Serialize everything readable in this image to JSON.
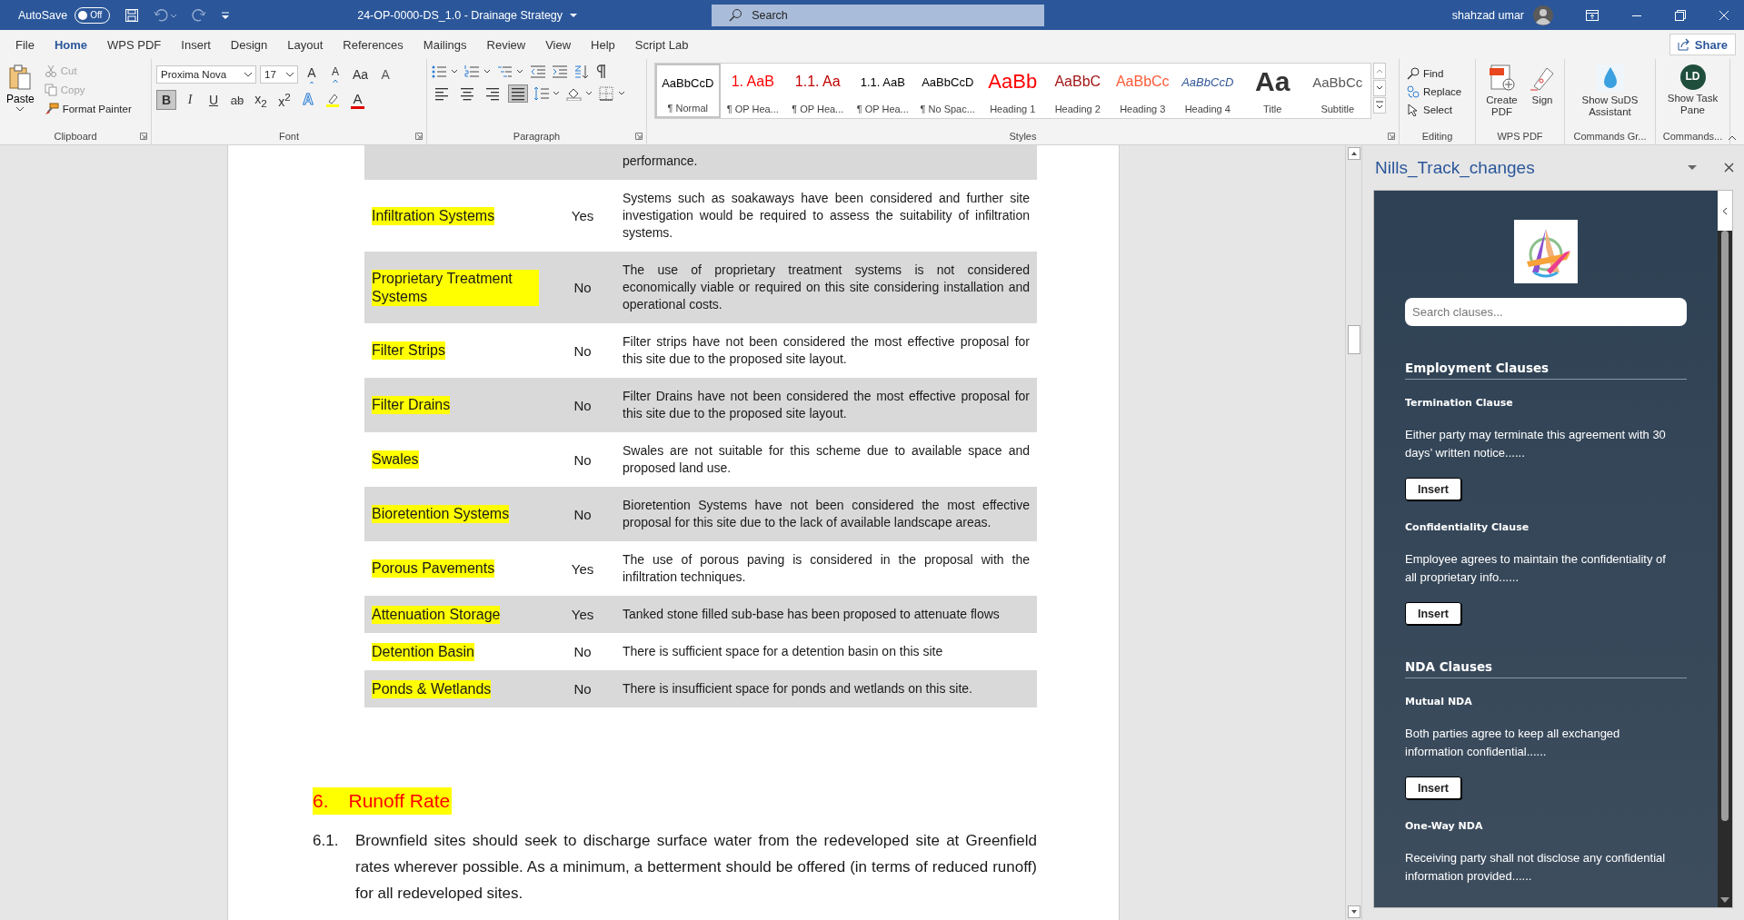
{
  "title_bar": {
    "autosave_label": "AutoSave",
    "autosave": {
      "label": "Off",
      "on": false
    },
    "document_title": "24-OP-0000-DS_1.0 - Drainage Strategy",
    "search_placeholder": "Search",
    "user_name": "shahzad umar"
  },
  "ribbon_tabs": [
    {
      "label": "File",
      "selected": false
    },
    {
      "label": "Home",
      "selected": true
    },
    {
      "label": "WPS PDF",
      "selected": false
    },
    {
      "label": "Insert",
      "selected": false
    },
    {
      "label": "Design",
      "selected": false
    },
    {
      "label": "Layout",
      "selected": false
    },
    {
      "label": "References",
      "selected": false
    },
    {
      "label": "Mailings",
      "selected": false
    },
    {
      "label": "Review",
      "selected": false
    },
    {
      "label": "View",
      "selected": false
    },
    {
      "label": "Help",
      "selected": false
    },
    {
      "label": "Script Lab",
      "selected": false
    }
  ],
  "share_button": "Share",
  "clipboard": {
    "paste": "Paste",
    "items": [
      {
        "label": "Cut",
        "kind": "cut",
        "disabled": true
      },
      {
        "label": "Copy",
        "kind": "copy",
        "disabled": true
      },
      {
        "label": "Format Painter",
        "kind": "painter",
        "disabled": false
      }
    ],
    "group_label": "Clipboard"
  },
  "font": {
    "font_name": "Proxima Nova",
    "font_size": "17",
    "row1": [
      {
        "label": "A",
        "kind": "grow"
      },
      {
        "label": "A",
        "kind": "shrink"
      },
      {
        "label": "Aa",
        "kind": "case"
      },
      {
        "label": "A",
        "kind": "clear"
      }
    ],
    "row2": [
      {
        "label": "B",
        "kind": "bold",
        "active": true
      },
      {
        "label": "I",
        "kind": "italic",
        "active": false
      },
      {
        "label": "U",
        "kind": "underline",
        "active": false
      },
      {
        "label": "ab",
        "kind": "strike",
        "active": false
      },
      {
        "label": "x$_{2}$",
        "kind": "subscript",
        "active": false
      },
      {
        "label": "x$^{2}$",
        "kind": "superscript",
        "active": false
      },
      {
        "label": "A",
        "kind": "effects",
        "active": false
      },
      {
        "kind": "highlight",
        "color": "#ffff00",
        "active": false
      },
      {
        "label": "A",
        "kind": "color",
        "color": "#e00000",
        "active": false
      }
    ],
    "group_label": "Font"
  },
  "paragraph": {
    "align_buttons": [
      {
        "kind": "left",
        "selected": false
      },
      {
        "kind": "center",
        "selected": false
      },
      {
        "kind": "right",
        "selected": false
      },
      {
        "kind": "justify",
        "selected": true
      }
    ],
    "group_label": "Paragraph"
  },
  "styles": {
    "items": [
      {
        "preview": "AaBbCcD",
        "name": "¶ Normal",
        "kind": "normal",
        "color": "#000000",
        "selected": true
      },
      {
        "preview": "1. AaB",
        "name": "¶ OP Hea...",
        "kind": "numbered",
        "color": "#ff0000",
        "selected": false
      },
      {
        "preview": "1.1. Aa",
        "name": "¶ OP Hea...",
        "kind": "numbered",
        "color": "#c00000",
        "selected": false
      },
      {
        "preview": "1.1. AaB",
        "name": "¶ OP Hea...",
        "kind": "normal",
        "color": "#000000",
        "selected": false
      },
      {
        "preview": "AaBbCcD",
        "name": "¶ No Spac...",
        "kind": "normal",
        "color": "#000000",
        "selected": false
      },
      {
        "preview": "AaBb",
        "name": "Heading 1",
        "kind": "heading1",
        "color": "#ff0000",
        "selected": false
      },
      {
        "preview": "AaBbC",
        "name": "Heading 2",
        "kind": "heading",
        "color": "#a31515",
        "selected": false
      },
      {
        "preview": "AaBbCc",
        "name": "Heading 3",
        "kind": "heading",
        "color": "#ff5a36",
        "selected": false
      },
      {
        "preview": "AaBbCcD",
        "name": "Heading 4",
        "kind": "italic",
        "color": "#2f5597",
        "selected": false
      },
      {
        "preview": "Aa",
        "name": "Title",
        "kind": "title",
        "color": "#333333",
        "selected": false
      },
      {
        "preview": "AaBbCc",
        "name": "Subtitle",
        "kind": "subtitle",
        "color": "#595959",
        "selected": false
      }
    ],
    "group_label": "Styles"
  },
  "editing": {
    "items": [
      {
        "label": "Find",
        "kind": "find"
      },
      {
        "label": "Replace",
        "kind": "replace"
      },
      {
        "label": "Select",
        "kind": "select"
      }
    ],
    "group_label": "Editing"
  },
  "wps_pdf": {
    "items": [
      {
        "label": "Create PDF",
        "kind": "create-pdf"
      },
      {
        "label": "Sign",
        "kind": "sign"
      }
    ],
    "group_label": "WPS PDF"
  },
  "commands_group": {
    "button": "Show SuDS Assistant",
    "group_label": "Commands Gr..."
  },
  "commands": {
    "button": "Show Task Pane",
    "icon_text": "LD",
    "group_label": "Commands..."
  },
  "document": {
    "table": {
      "rows": [
        {
          "notes": "performance."
        },
        {
          "measure": "Infiltration Systems",
          "used": "Yes",
          "notes": "Systems such as soakaways have been considered and further site investigation would be required to assess the suitability of infiltration systems.",
          "highlighted": true
        },
        {
          "measure": "Proprietary Treatment Systems",
          "used": "No",
          "notes": "The use of proprietary treatment systems is not considered economically viable or required on this site considering installation and operational costs.",
          "highlighted": true
        },
        {
          "measure": "Filter Strips",
          "used": "No",
          "notes": "Filter strips have not been considered the most effective proposal for this site due to the proposed site layout.",
          "highlighted": true
        },
        {
          "measure": "Filter Drains",
          "used": "No",
          "notes": "Filter Drains have not been considered the most effective proposal for this site due to the proposed site layout.",
          "highlighted": true
        },
        {
          "measure": "Swales",
          "used": "No",
          "notes": "Swales are not suitable for this scheme due to available space and proposed land use.",
          "highlighted": true
        },
        {
          "measure": "Bioretention Systems",
          "used": "No",
          "notes": "Bioretention Systems have not been considered the most effective proposal for this site due to the lack of available landscape areas.",
          "highlighted": true
        },
        {
          "measure": "Porous Pavements",
          "used": "Yes",
          "notes": "The use of porous paving is considered in the proposal with the infiltration techniques.",
          "highlighted": true
        },
        {
          "measure": "Attenuation Storage",
          "used": "Yes",
          "notes": "Tanked stone filled sub-base has been proposed to attenuate flows",
          "highlighted": true
        },
        {
          "measure": "Detention Basin",
          "used": "No",
          "notes": "There is sufficient space for a detention basin on this site",
          "highlighted": true
        },
        {
          "measure": "Ponds & Wetlands",
          "used": "No",
          "notes": "There is insufficient space for ponds and wetlands on this site.",
          "highlighted": true
        }
      ]
    },
    "heading": {
      "number": "6.",
      "text": "Runoff Rate",
      "highlighted": true
    },
    "paragraph": {
      "number": "6.1.",
      "text": "Brownfield sites should seek to discharge surface water from the redeveloped site at Greenfield rates wherever possible. As a minimum, a betterment should be offered (in terms of reduced runoff) for all redeveloped sites."
    }
  },
  "task_pane": {
    "title": "Nills_Track_changes",
    "search_placeholder": "Search clauses...",
    "sections": [
      {
        "heading": "Employment Clauses",
        "clauses": [
          {
            "title": "Termination Clause",
            "text": "Either party may terminate this agreement with 30 days’ written notice......",
            "button": "Insert"
          },
          {
            "title": "Confidentiality Clause",
            "text": "Employee agrees to maintain the confidentiality of all proprietary info......",
            "button": "Insert"
          }
        ]
      },
      {
        "heading": "NDA Clauses",
        "clauses": [
          {
            "title": "Mutual NDA",
            "text": "Both parties agree to keep all exchanged information confidential......",
            "button": "Insert"
          },
          {
            "title": "One-Way NDA",
            "text": "Receiving party shall not disclose any confidential information provided......"
          }
        ]
      }
    ]
  }
}
